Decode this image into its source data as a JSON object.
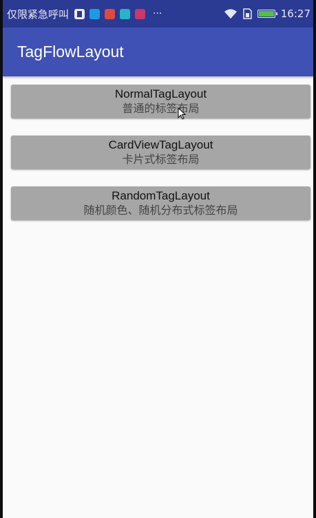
{
  "status_bar": {
    "carrier_text": "仅限紧急呼叫",
    "notification_icons": [
      "document-icon",
      "mail-icon",
      "heart-icon",
      "game-icon",
      "app-icon"
    ],
    "more_indicator": "···",
    "time": "16:27",
    "battery_level": 1.0,
    "colors": {
      "background": "#2b3a92",
      "battery_fill": "#52c43a"
    }
  },
  "app_bar": {
    "title": "TagFlowLayout",
    "color": "#3f51b5"
  },
  "buttons": [
    {
      "title": "NormalTagLayout",
      "subtitle": "普通的标签布局"
    },
    {
      "title": "CardViewTagLayout",
      "subtitle": "卡片式标签布局"
    },
    {
      "title": "RandomTagLayout",
      "subtitle": "随机颜色、随机分布式标签布局"
    }
  ],
  "colors": {
    "button_background": "#a6a6a6",
    "page_background": "#fafafa"
  }
}
